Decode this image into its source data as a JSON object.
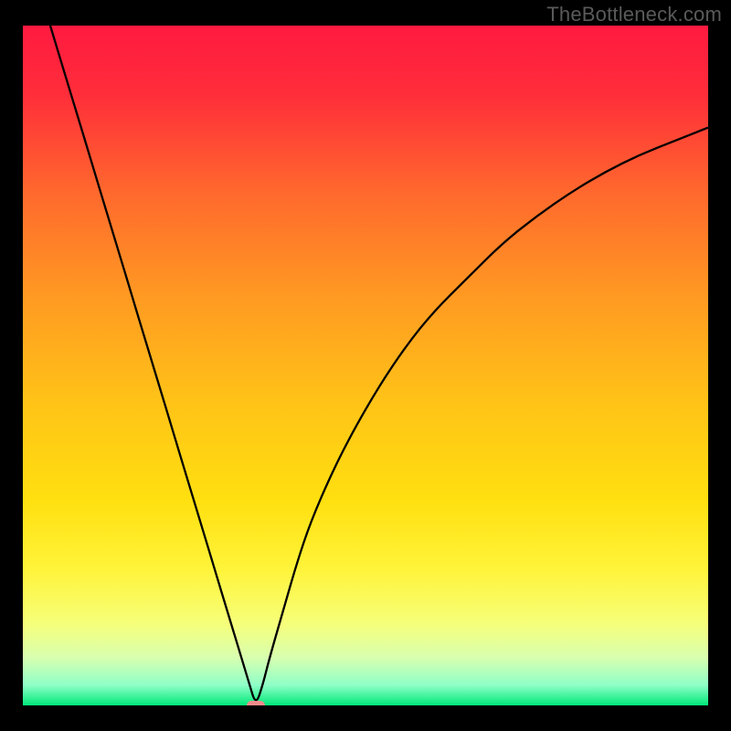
{
  "watermark": "TheBottleneck.com",
  "chart_data": {
    "type": "line",
    "title": "",
    "xlabel": "",
    "ylabel": "",
    "x_range": [
      0,
      100
    ],
    "y_range": [
      0,
      100
    ],
    "minimum_x": 34,
    "minimum_y": 0,
    "series": [
      {
        "name": "bottleneck-curve",
        "x": [
          4,
          6,
          8,
          10,
          12,
          14,
          16,
          18,
          20,
          22,
          24,
          26,
          28,
          30,
          32,
          33,
          34,
          35,
          36,
          38,
          40,
          42,
          45,
          48,
          52,
          56,
          60,
          65,
          70,
          75,
          80,
          85,
          90,
          95,
          100
        ],
        "y": [
          100,
          93.3,
          86.7,
          80,
          73.3,
          66.7,
          60,
          53.3,
          46.7,
          40,
          33.3,
          26.7,
          20,
          13.3,
          6.7,
          3.3,
          0,
          3,
          7,
          14,
          21,
          27,
          34,
          40,
          47,
          53,
          58,
          63,
          68,
          72,
          75.5,
          78.5,
          81,
          83,
          85
        ]
      }
    ],
    "background_gradient": {
      "stops": [
        {
          "offset": 0.0,
          "color": "#ff1a40"
        },
        {
          "offset": 0.1,
          "color": "#ff2d3a"
        },
        {
          "offset": 0.25,
          "color": "#ff6a2d"
        },
        {
          "offset": 0.4,
          "color": "#ff9a22"
        },
        {
          "offset": 0.55,
          "color": "#ffc217"
        },
        {
          "offset": 0.7,
          "color": "#ffe010"
        },
        {
          "offset": 0.8,
          "color": "#fff43a"
        },
        {
          "offset": 0.88,
          "color": "#f6ff7a"
        },
        {
          "offset": 0.93,
          "color": "#d8ffb0"
        },
        {
          "offset": 0.97,
          "color": "#8fffc8"
        },
        {
          "offset": 1.0,
          "color": "#00e878"
        }
      ]
    },
    "marker": {
      "x": 34,
      "y": 0,
      "color": "#f08c8c"
    }
  }
}
